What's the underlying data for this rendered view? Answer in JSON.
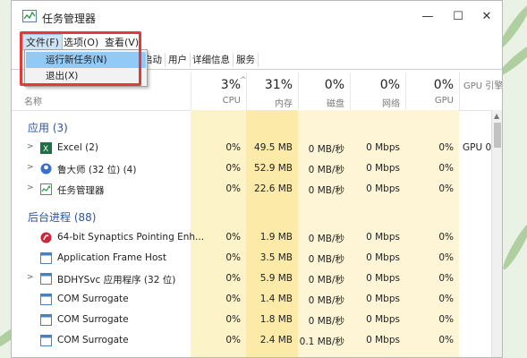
{
  "window": {
    "title": "任务管理器",
    "min_glyph": "—",
    "max_glyph": "☐",
    "close_glyph": "✕"
  },
  "menu": {
    "file": "文件(F)",
    "options": "选项(O)",
    "view": "查看(V)"
  },
  "file_menu_items": [
    "运行新任务(N)",
    "退出(X)"
  ],
  "tabs": [
    "启动",
    "用户",
    "详细信息",
    "服务"
  ],
  "header": {
    "name": "名称",
    "columns": [
      {
        "label": "CPU",
        "pct": "3%"
      },
      {
        "label": "内存",
        "pct": "31%"
      },
      {
        "label": "磁盘",
        "pct": "0%"
      },
      {
        "label": "网络",
        "pct": "0%"
      },
      {
        "label": "GPU",
        "pct": "0%"
      },
      {
        "label": "GPU 引擎",
        "pct": ""
      }
    ]
  },
  "groups": {
    "apps": "应用 (3)",
    "background": "后台进程 (88)"
  },
  "apps": [
    {
      "name": "Excel (2)",
      "icon": "excel-icon",
      "cpu": "0%",
      "mem": "49.5 MB",
      "disk": "0 MB/秒",
      "net": "0 Mbps",
      "gpu": "0%",
      "engine": "GPU 0"
    },
    {
      "name": "鲁大师 (32 位) (4)",
      "icon": "ludashi-icon",
      "cpu": "0%",
      "mem": "52.9 MB",
      "disk": "0 MB/秒",
      "net": "0 Mbps",
      "gpu": "0%",
      "engine": ""
    },
    {
      "name": "任务管理器",
      "icon": "task-manager-icon",
      "cpu": "0%",
      "mem": "22.6 MB",
      "disk": "0 MB/秒",
      "net": "0 Mbps",
      "gpu": "0%",
      "engine": ""
    }
  ],
  "background": [
    {
      "name": "64-bit Synaptics Pointing Enh...",
      "icon": "synaptics-icon",
      "cpu": "0%",
      "mem": "1.9 MB",
      "disk": "0 MB/秒",
      "net": "0 Mbps",
      "gpu": "0%",
      "engine": ""
    },
    {
      "name": "Application Frame Host",
      "icon": "window-icon",
      "cpu": "0%",
      "mem": "3.5 MB",
      "disk": "0 MB/秒",
      "net": "0 Mbps",
      "gpu": "0%",
      "engine": ""
    },
    {
      "name": "BDHYSvc 应用程序 (32 位)",
      "icon": "window-icon",
      "cpu": "0%",
      "mem": "5.9 MB",
      "disk": "0 MB/秒",
      "net": "0 Mbps",
      "gpu": "0%",
      "engine": ""
    },
    {
      "name": "COM Surrogate",
      "icon": "window-icon",
      "cpu": "0%",
      "mem": "1.4 MB",
      "disk": "0 MB/秒",
      "net": "0 Mbps",
      "gpu": "0%",
      "engine": ""
    },
    {
      "name": "COM Surrogate",
      "icon": "window-icon",
      "cpu": "0%",
      "mem": "1.8 MB",
      "disk": "0 MB/秒",
      "net": "0 Mbps",
      "gpu": "0%",
      "engine": ""
    },
    {
      "name": "COM Surrogate",
      "icon": "window-icon",
      "cpu": "0%",
      "mem": "2.4 MB",
      "disk": "0.1 MB/秒",
      "net": "0 Mbps",
      "gpu": "0%",
      "engine": ""
    }
  ],
  "colors": {
    "accent_highlight": "#e03a3a",
    "menu_selection": "#91c9f7",
    "heat_bg": "#fdf5d6",
    "group_text": "#2a55a0"
  }
}
